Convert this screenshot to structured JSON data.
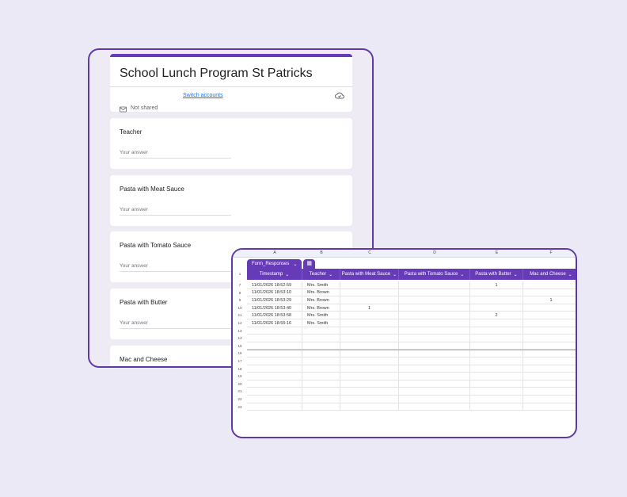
{
  "form": {
    "title": "School Lunch Program St Patricks",
    "switch_accounts": "Switch accounts",
    "not_shared": "Not shared",
    "questions": [
      {
        "label": "Teacher",
        "placeholder": "Your answer"
      },
      {
        "label": "Pasta with Meat Sauce",
        "placeholder": "Your answer"
      },
      {
        "label": "Pasta with Tomato Sauce",
        "placeholder": "Your answer"
      },
      {
        "label": "Pasta with Butter",
        "placeholder": "Your answer"
      },
      {
        "label": "Mac and Cheese",
        "placeholder": ""
      }
    ]
  },
  "sheet": {
    "tab_name": "Form_Responses",
    "column_letters": [
      "A",
      "B",
      "C",
      "D",
      "E",
      "F"
    ],
    "headers": [
      "Timestamp",
      "Teacher",
      "Pasta with Meat Sauce",
      "Pasta with Tomato Sauce",
      "Pasta with Butter",
      "Mac and Cheese"
    ],
    "header_row_number": "1",
    "rows": [
      {
        "num": "7",
        "cells": [
          "11/01/2026 18:52:59",
          "Mrs. Smith",
          "",
          "",
          "1",
          ""
        ]
      },
      {
        "num": "8",
        "cells": [
          "11/01/2026 18:53:10",
          "Mrs. Brown",
          "",
          "",
          "",
          ""
        ]
      },
      {
        "num": "9",
        "cells": [
          "11/01/2026 18:53:29",
          "Mrs. Brown",
          "",
          "",
          "",
          "1"
        ]
      },
      {
        "num": "10",
        "cells": [
          "11/01/2026 18:53:40",
          "Mrs. Brown",
          "1",
          "",
          "",
          ""
        ]
      },
      {
        "num": "11",
        "cells": [
          "11/01/2026 18:53:58",
          "Mrs. Smith",
          "",
          "",
          "2",
          ""
        ]
      },
      {
        "num": "12",
        "cells": [
          "11/01/2026 18:55:16",
          "Mrs. Smith",
          "",
          "",
          "",
          ""
        ]
      }
    ],
    "empty_row_numbers": [
      "13",
      "14",
      "15",
      "16",
      "17",
      "18",
      "19",
      "20",
      "21",
      "22",
      "23"
    ]
  },
  "colors": {
    "accent": "#673ab7",
    "frame": "#5e3aa5",
    "background": "#ece9f7"
  },
  "icons": {
    "cloud": "cloud-save-icon",
    "mail": "mail-icon",
    "caret": "caret-down-icon",
    "grid": "table-icon"
  }
}
